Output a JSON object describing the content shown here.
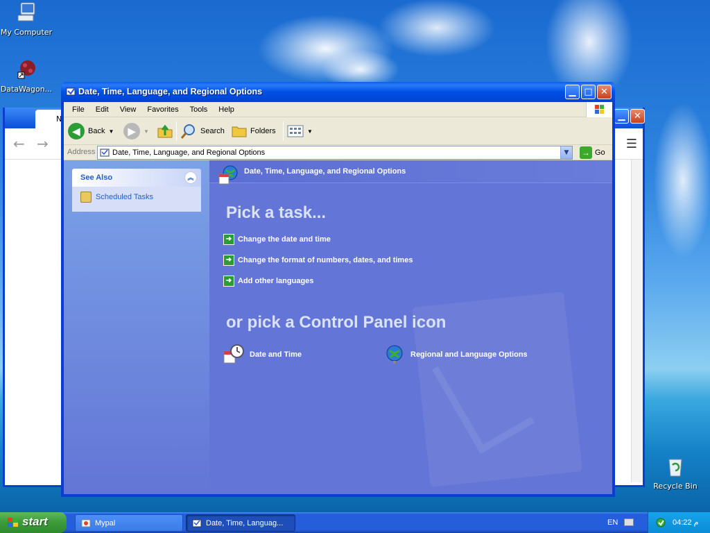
{
  "desktop": {
    "icons": [
      {
        "label": "My Computer"
      },
      {
        "label": "DataWagon..."
      },
      {
        "label": "Recycle Bin"
      }
    ]
  },
  "background_window": {
    "tab_label": "Ne"
  },
  "window": {
    "title": "Date, Time, Language, and Regional Options",
    "menu": [
      "File",
      "Edit",
      "View",
      "Favorites",
      "Tools",
      "Help"
    ],
    "toolbar": {
      "back": "Back",
      "search": "Search",
      "folders": "Folders"
    },
    "address": {
      "label": "Address",
      "value": "Date, Time, Language, and Regional Options",
      "go": "Go"
    },
    "see_also": {
      "header": "See Also",
      "items": [
        "Scheduled Tasks"
      ]
    },
    "header": "Date, Time, Language, and Regional Options",
    "pick_task": "Pick a task...",
    "tasks": [
      "Change the date and time",
      "Change the format of numbers, dates, and times",
      "Add other languages"
    ],
    "pick_icon": "or pick a Control Panel icon",
    "cp_icons": [
      "Date and Time",
      "Regional and Language Options"
    ]
  },
  "taskbar": {
    "start": "start",
    "buttons": [
      {
        "label": "Mypal"
      },
      {
        "label": "Date, Time, Languag..."
      }
    ],
    "language": "EN",
    "clock": "04:22 م"
  }
}
